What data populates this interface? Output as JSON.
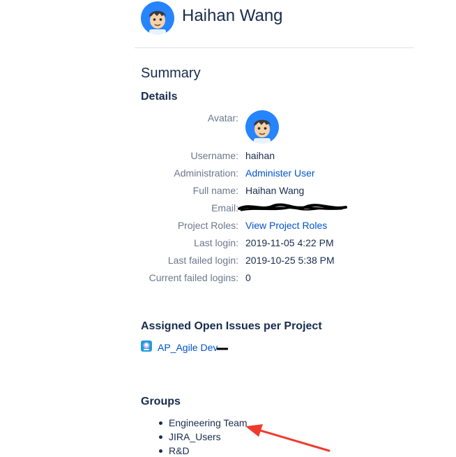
{
  "header": {
    "name": "Haihan Wang"
  },
  "summary": {
    "heading": "Summary",
    "details_heading": "Details",
    "avatar_label": "Avatar:",
    "fields": [
      {
        "label": "Username:",
        "value": "haihan"
      },
      {
        "label": "Administration:",
        "value": "Administer User"
      },
      {
        "label": "Full name:",
        "value": "Haihan Wang"
      },
      {
        "label": "Email:",
        "value": ""
      },
      {
        "label": "Project Roles:",
        "value": "View Project Roles"
      },
      {
        "label": "Last login:",
        "value": "2019-11-05 4:22 PM"
      },
      {
        "label": "Last failed login:",
        "value": "2019-10-25 5:38 PM"
      },
      {
        "label": "Current failed logins:",
        "value": "0"
      }
    ]
  },
  "issues": {
    "heading": "Assigned Open Issues per Project",
    "projects": [
      {
        "name": "AP_Agile Dev"
      }
    ]
  },
  "groups": {
    "heading": "Groups",
    "items": [
      "Engineering Team",
      "JIRA_Users",
      "R&D"
    ]
  },
  "colors": {
    "link": "#0052cc",
    "text": "#172b4d",
    "label": "#6b778c",
    "avatar_bg": "#2684ff",
    "annotation": "#f03a2e"
  },
  "icons": {
    "avatar": "user-avatar-icon",
    "project": "project-icon",
    "annotation": "red-arrow"
  }
}
